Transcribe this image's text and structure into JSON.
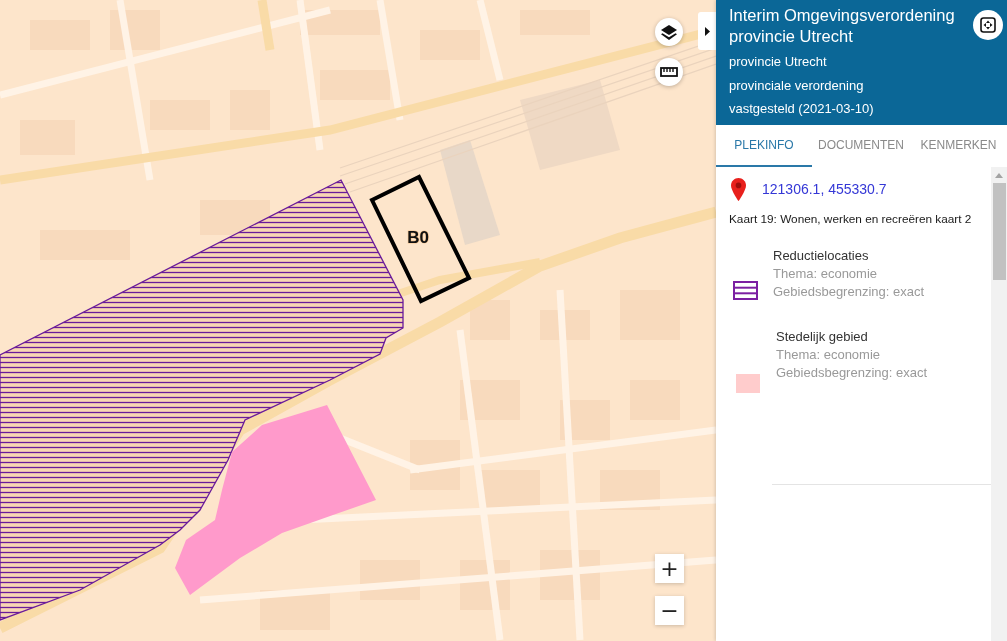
{
  "map": {
    "overlay_label": "B0",
    "zoom_in": "+",
    "zoom_out": "−"
  },
  "panel": {
    "title": "Interim Omgevingsverordening provincie Utrecht",
    "subtitle_lines": [
      "provincie Utrecht",
      "provinciale verordening",
      "vastgesteld (2021-03-10)"
    ],
    "tabs": [
      {
        "label": "PLEKINFO",
        "selected": true
      },
      {
        "label": "DOCUMENTEN",
        "selected": false
      },
      {
        "label": "KENMERKEN",
        "selected": false
      }
    ],
    "coordinates": "121306.1, 455330.7",
    "map_name": "Kaart 19: Wonen, werken en recreëren kaart 2",
    "legend": [
      {
        "kind": "hatched",
        "color": "#7b1fa2",
        "name": "Reductielocaties",
        "details": [
          "Thema: economie",
          "Gebiedsbegrenzing: exact"
        ]
      },
      {
        "kind": "fill",
        "color": "#ffcccc",
        "name": "Stedelijk gebied",
        "details": [
          "Thema: economie",
          "Gebiedsbegrenzing: exact"
        ]
      }
    ]
  }
}
